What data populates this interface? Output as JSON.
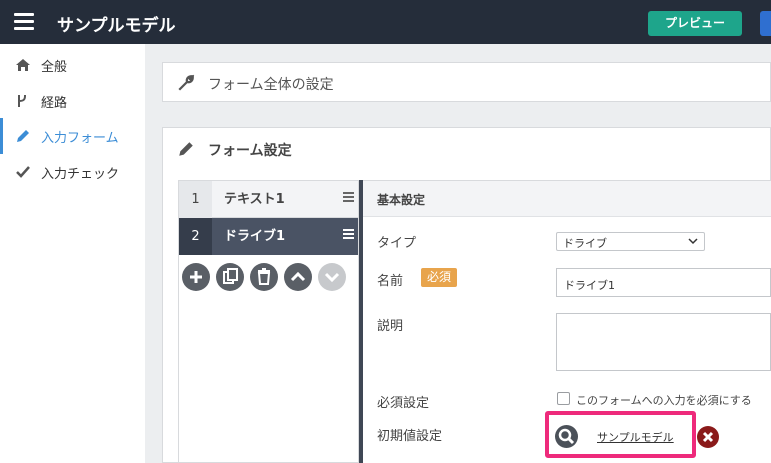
{
  "header": {
    "title": "サンプルモデル",
    "preview_label": "プレビュー",
    "colors": {
      "bar": "#252d3a",
      "preview": "#1ea58b"
    }
  },
  "sidebar": {
    "items": [
      {
        "label": "全般",
        "icon": "home-icon",
        "active": false
      },
      {
        "label": "経路",
        "icon": "branch-icon",
        "active": false
      },
      {
        "label": "入力フォーム",
        "icon": "pencil-icon",
        "active": true
      },
      {
        "label": "入力チェック",
        "icon": "check-icon",
        "active": false
      }
    ],
    "accent": "#3c8dd6"
  },
  "main": {
    "overall_panel_title": "フォーム全体の設定",
    "form_panel_title": "フォーム設定",
    "fields": [
      {
        "num": "1",
        "name": "テキスト1",
        "selected": false
      },
      {
        "num": "2",
        "name": "ドライブ1",
        "selected": true
      }
    ],
    "actions": [
      "add-icon",
      "copy-icon",
      "trash-icon",
      "arrow-up-icon",
      "arrow-down-icon"
    ],
    "detail": {
      "section_title": "基本設定",
      "type_label": "タイプ",
      "type_value": "ドライブ",
      "name_label": "名前",
      "required_badge": "必須",
      "name_value": "ドライブ1",
      "description_label": "説明",
      "required_setting_label": "必須設定",
      "required_checkbox_label": "このフォームへの入力を必須にする",
      "default_label": "初期値設定",
      "default_link": "サンプルモデル"
    }
  }
}
